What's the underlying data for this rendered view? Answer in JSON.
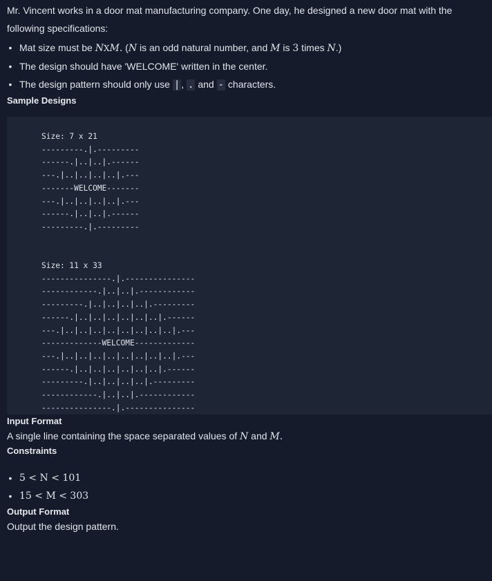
{
  "intro": {
    "line": "Mr. Vincent works in a door mat manufacturing company. One day, he designed a new door mat with the following specifications:"
  },
  "specs": [
    {
      "pre": "Mat size must be ",
      "n": "N",
      "times": "X",
      "m": "M",
      "dot": ".",
      "paren_open": " (",
      "n2": "N",
      "mid": " is an odd natural number, and ",
      "m2": "M",
      "is": " is ",
      "three": "3",
      "times_word": " times ",
      "n3": "N",
      "end": ".)"
    },
    {
      "text": "The design should have 'WELCOME' written in the center."
    },
    {
      "pre": "The design pattern should only use ",
      "c1": "|",
      "sep1": ", ",
      "c2": ".",
      "sep2": " and ",
      "c3": "-",
      "end": " characters."
    }
  ],
  "sample_heading": "Sample Designs",
  "sample_small": {
    "size_label": "Size: 7 x 21",
    "lines": [
      "---------.|.---------",
      "------.|..|..|.------",
      "---.|..|..|..|..|.---",
      "-------WELCOME-------",
      "---.|..|..|..|..|.---",
      "------.|..|..|.------",
      "---------.|.---------"
    ]
  },
  "sample_large": {
    "size_label": "Size: 11 x 33",
    "lines": [
      "---------------.|.---------------",
      "------------.|..|..|.------------",
      "---------.|..|..|..|..|.---------",
      "------.|..|..|..|..|..|..|.------",
      "---.|..|..|..|..|..|..|..|..|.---",
      "-------------WELCOME-------------",
      "---.|..|..|..|..|..|..|..|..|.---",
      "------.|..|..|..|..|..|..|.------",
      "---------.|..|..|..|..|.---------",
      "------------.|..|..|.------------",
      "---------------.|.---------------"
    ]
  },
  "input_heading": "Input Format",
  "input_text": {
    "pre": "A single line containing the space separated values of ",
    "n": "N",
    "and": " and ",
    "m": "M",
    "end": "."
  },
  "constraints_heading": "Constraints",
  "constraints": [
    {
      "text": "5 < N < 101"
    },
    {
      "text": "15 < M < 303"
    }
  ],
  "output_heading": "Output Format",
  "output_text": "Output the design pattern.",
  "bullet": "•"
}
